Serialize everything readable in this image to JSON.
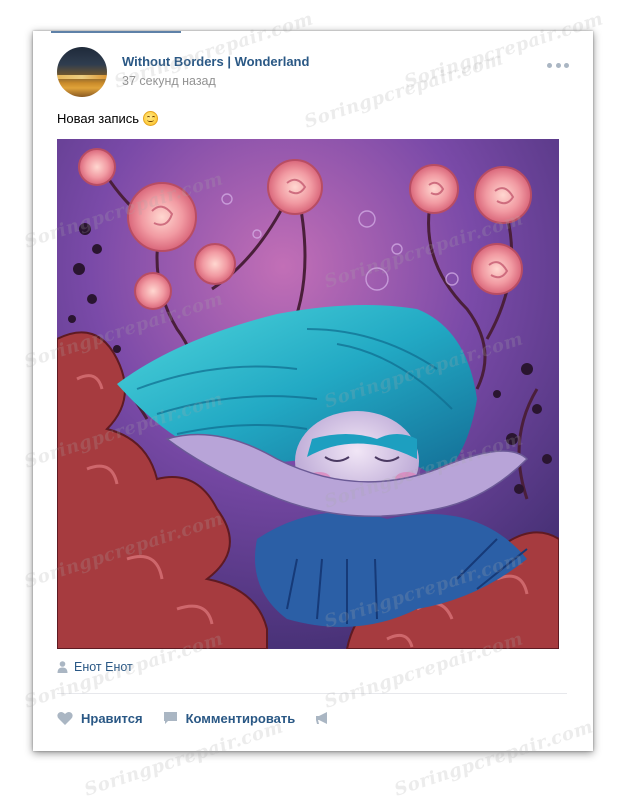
{
  "post": {
    "author": "Without Borders | Wonderland",
    "time": "37 секунд назад",
    "text": "Новая запись",
    "emoji": "blush-smile-emoji",
    "photo_description_icon": "painting-girl-with-turquoise-hair-and-roses",
    "signature": "Енот Енот"
  },
  "actions": {
    "like_label": "Нравится",
    "comment_label": "Комментировать"
  },
  "watermark": {
    "text": "Soringpcrepair.com"
  },
  "colors": {
    "link": "#2a5885",
    "muted": "#939393",
    "icon": "#aab6c3",
    "divider": "#e7e8ec"
  }
}
